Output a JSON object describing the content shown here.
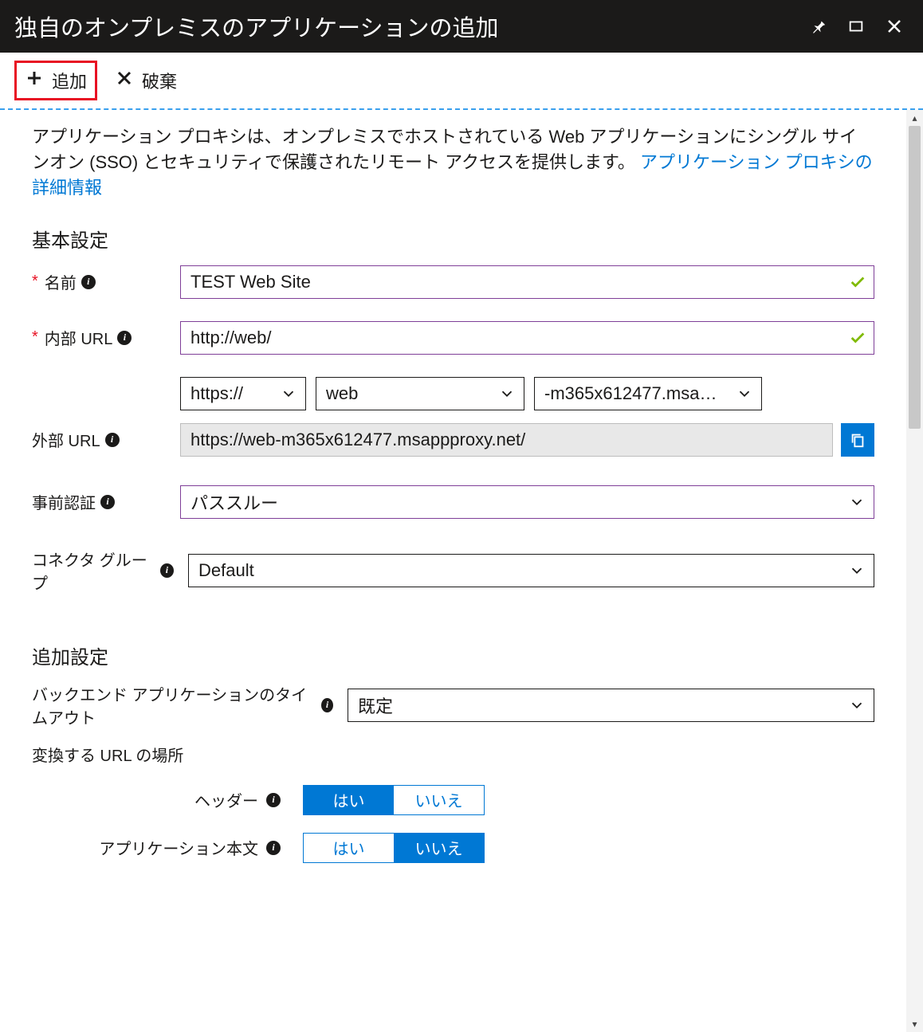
{
  "title": "独自のオンプレミスのアプリケーションの追加",
  "toolbar": {
    "add_label": "追加",
    "discard_label": "破棄"
  },
  "intro": {
    "text": "アプリケーション プロキシは、オンプレミスでホストされている Web アプリケーションにシングル サインオン (SSO) とセキュリティで保護されたリモート アクセスを提供します。",
    "link_text": "アプリケーション プロキシの詳細情報"
  },
  "sections": {
    "basic": "基本設定",
    "advanced": "追加設定"
  },
  "labels": {
    "name": "名前",
    "internal_url": "内部 URL",
    "external_url": "外部 URL",
    "preauth": "事前認証",
    "connector_group": "コネクタ グループ",
    "backend_timeout": "バックエンド アプリケーションのタイムアウト",
    "translate_url": "変換する URL の場所",
    "header": "ヘッダー",
    "app_body": "アプリケーション本文"
  },
  "values": {
    "name": "TEST Web Site",
    "internal_url": "http://web/",
    "ext_scheme": "https://",
    "ext_host": "web",
    "ext_suffix": "-m365x612477.msa…",
    "external_url_full": "https://web-m365x612477.msappproxy.net/",
    "preauth": "パススルー",
    "connector_group": "Default",
    "backend_timeout": "既定"
  },
  "toggle": {
    "yes": "はい",
    "no": "いいえ"
  }
}
